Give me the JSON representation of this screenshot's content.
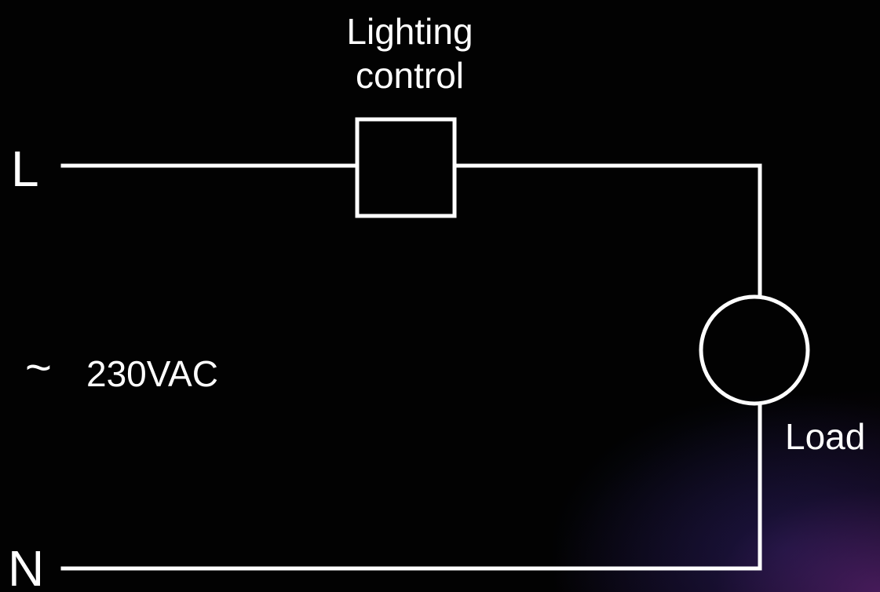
{
  "labels": {
    "line": "L",
    "neutral": "N",
    "control_line1": "Lighting",
    "control_line2": "control",
    "load": "Load",
    "tilde": "~",
    "voltage": "230VAC"
  },
  "colors": {
    "background": "#000000",
    "wire": "#ffffff",
    "text": "#ffffff"
  }
}
